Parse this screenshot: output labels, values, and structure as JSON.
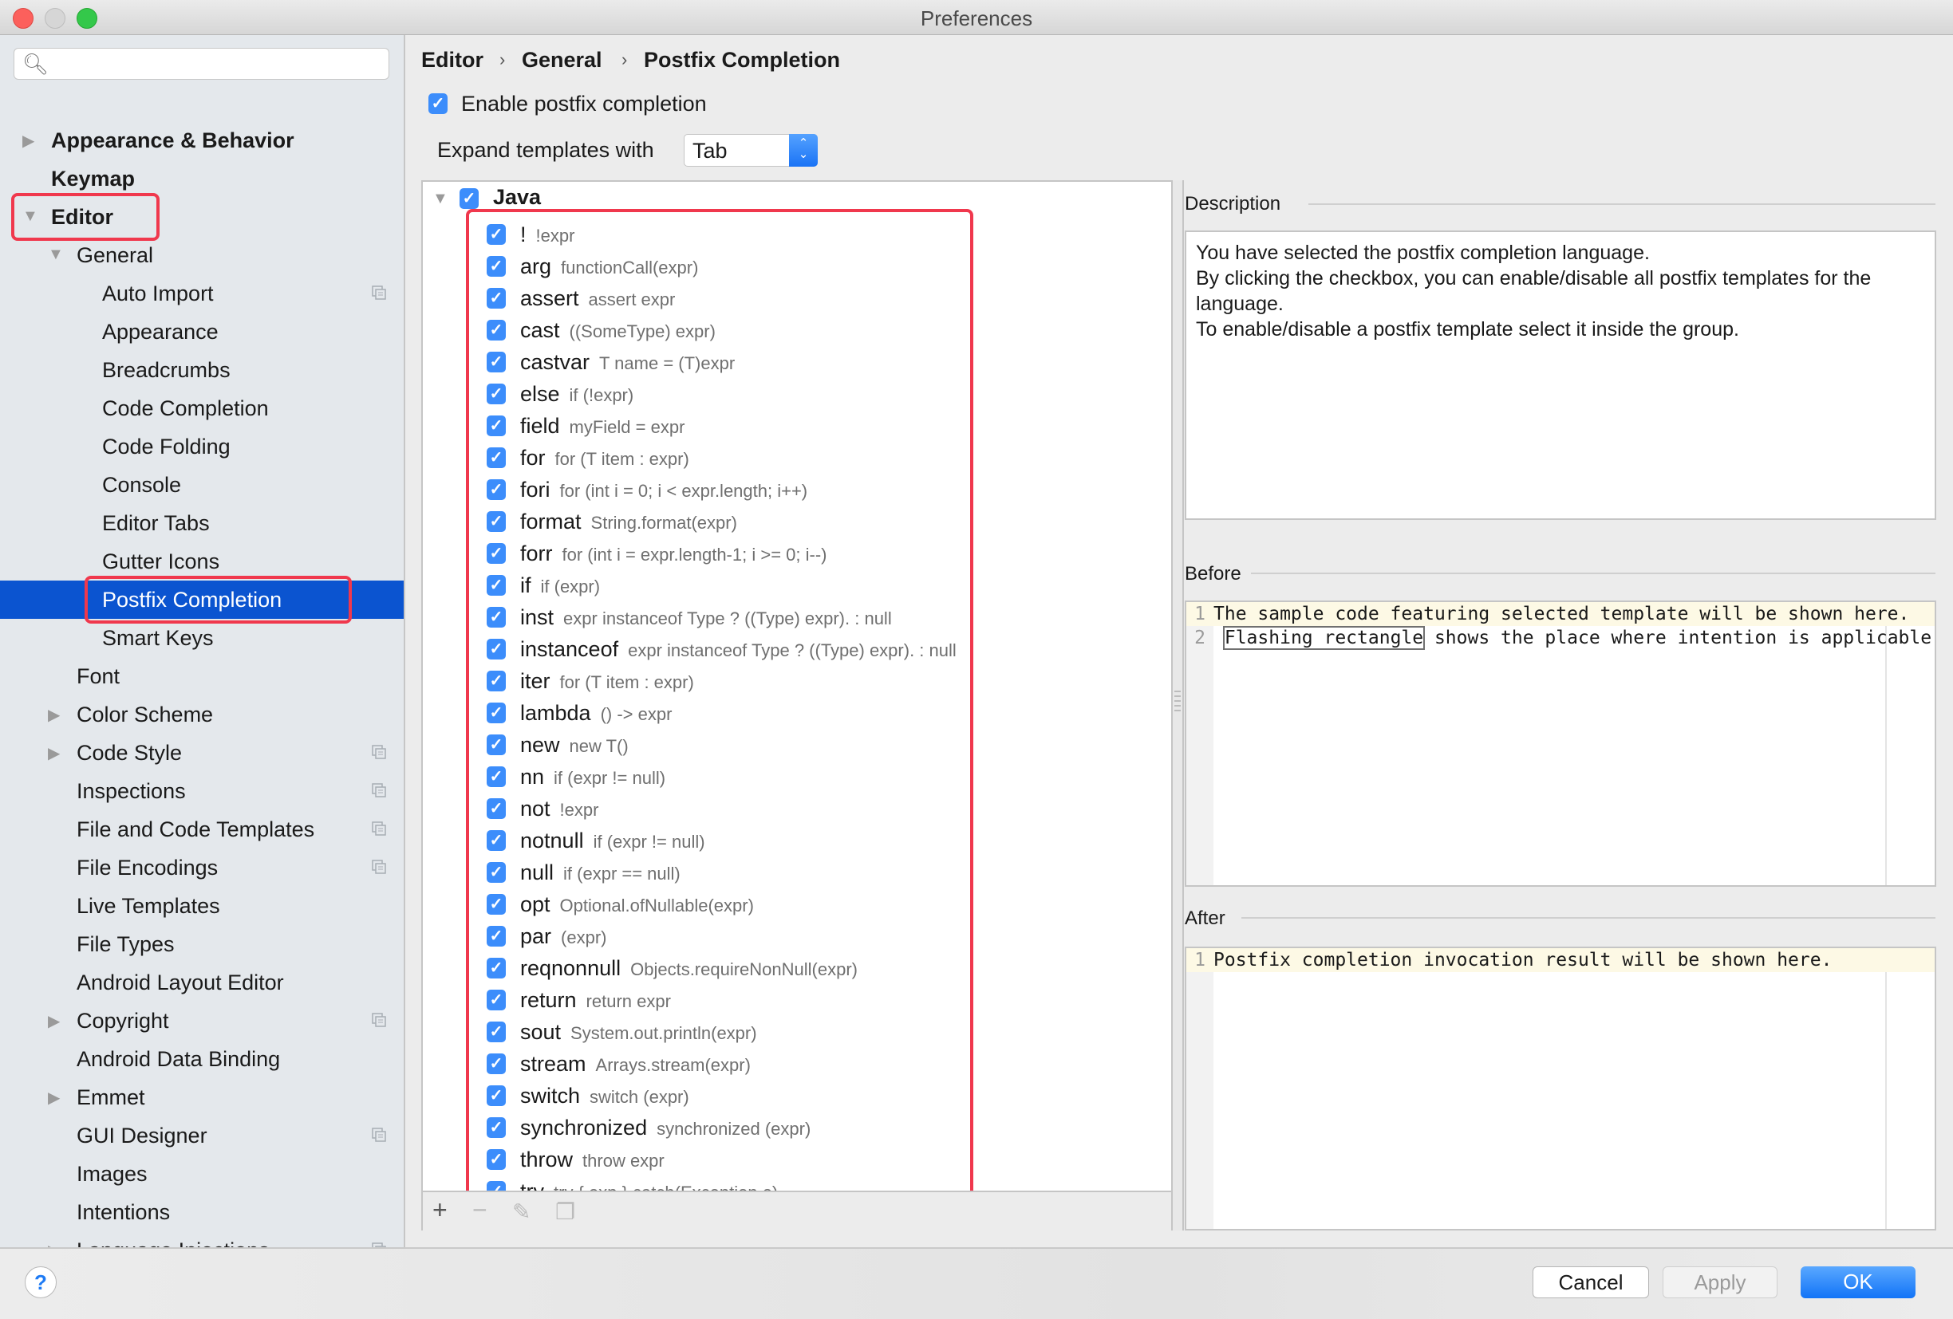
{
  "window": {
    "title": "Preferences"
  },
  "sidebar": {
    "search_placeholder": "",
    "items": [
      {
        "label": "Appearance & Behavior",
        "level": 0,
        "bold": true,
        "arrow": "collapsed",
        "project_icon": false
      },
      {
        "label": "Keymap",
        "level": 0,
        "bold": true,
        "arrow": "none",
        "project_icon": false
      },
      {
        "label": "Editor",
        "level": 0,
        "bold": true,
        "arrow": "expanded",
        "project_icon": false,
        "highlighted": true
      },
      {
        "label": "General",
        "level": 1,
        "bold": false,
        "arrow": "expanded",
        "project_icon": false
      },
      {
        "label": "Auto Import",
        "level": 2,
        "bold": false,
        "arrow": "none",
        "project_icon": true
      },
      {
        "label": "Appearance",
        "level": 2,
        "bold": false,
        "arrow": "none",
        "project_icon": false
      },
      {
        "label": "Breadcrumbs",
        "level": 2,
        "bold": false,
        "arrow": "none",
        "project_icon": false
      },
      {
        "label": "Code Completion",
        "level": 2,
        "bold": false,
        "arrow": "none",
        "project_icon": false
      },
      {
        "label": "Code Folding",
        "level": 2,
        "bold": false,
        "arrow": "none",
        "project_icon": false
      },
      {
        "label": "Console",
        "level": 2,
        "bold": false,
        "arrow": "none",
        "project_icon": false
      },
      {
        "label": "Editor Tabs",
        "level": 2,
        "bold": false,
        "arrow": "none",
        "project_icon": false
      },
      {
        "label": "Gutter Icons",
        "level": 2,
        "bold": false,
        "arrow": "none",
        "project_icon": false
      },
      {
        "label": "Postfix Completion",
        "level": 2,
        "bold": false,
        "arrow": "none",
        "project_icon": false,
        "selected": true,
        "highlighted": true
      },
      {
        "label": "Smart Keys",
        "level": 2,
        "bold": false,
        "arrow": "none",
        "project_icon": false
      },
      {
        "label": "Font",
        "level": 1,
        "bold": false,
        "arrow": "none",
        "project_icon": false
      },
      {
        "label": "Color Scheme",
        "level": 1,
        "bold": false,
        "arrow": "collapsed",
        "project_icon": false
      },
      {
        "label": "Code Style",
        "level": 1,
        "bold": false,
        "arrow": "collapsed",
        "project_icon": true
      },
      {
        "label": "Inspections",
        "level": 1,
        "bold": false,
        "arrow": "none",
        "project_icon": true
      },
      {
        "label": "File and Code Templates",
        "level": 1,
        "bold": false,
        "arrow": "none",
        "project_icon": true
      },
      {
        "label": "File Encodings",
        "level": 1,
        "bold": false,
        "arrow": "none",
        "project_icon": true
      },
      {
        "label": "Live Templates",
        "level": 1,
        "bold": false,
        "arrow": "none",
        "project_icon": false
      },
      {
        "label": "File Types",
        "level": 1,
        "bold": false,
        "arrow": "none",
        "project_icon": false
      },
      {
        "label": "Android Layout Editor",
        "level": 1,
        "bold": false,
        "arrow": "none",
        "project_icon": false
      },
      {
        "label": "Copyright",
        "level": 1,
        "bold": false,
        "arrow": "collapsed",
        "project_icon": true
      },
      {
        "label": "Android Data Binding",
        "level": 1,
        "bold": false,
        "arrow": "none",
        "project_icon": false
      },
      {
        "label": "Emmet",
        "level": 1,
        "bold": false,
        "arrow": "collapsed",
        "project_icon": false
      },
      {
        "label": "GUI Designer",
        "level": 1,
        "bold": false,
        "arrow": "none",
        "project_icon": true
      },
      {
        "label": "Images",
        "level": 1,
        "bold": false,
        "arrow": "none",
        "project_icon": false
      },
      {
        "label": "Intentions",
        "level": 1,
        "bold": false,
        "arrow": "none",
        "project_icon": false
      },
      {
        "label": "Language Injections",
        "level": 1,
        "bold": false,
        "arrow": "collapsed",
        "project_icon": true
      }
    ]
  },
  "breadcrumb": [
    "Editor",
    "General",
    "Postfix Completion"
  ],
  "breadcrumb_separator": "›",
  "enable_postfix": {
    "label": "Enable postfix completion",
    "checked": true
  },
  "expand_with": {
    "label": "Expand templates with",
    "value": "Tab"
  },
  "tree": {
    "group": {
      "label": "Java",
      "checked": true,
      "expanded": true
    },
    "templates": [
      {
        "key": "!",
        "desc": "!expr",
        "checked": true
      },
      {
        "key": "arg",
        "desc": "functionCall(expr)",
        "checked": true
      },
      {
        "key": "assert",
        "desc": "assert expr",
        "checked": true
      },
      {
        "key": "cast",
        "desc": "((SomeType) expr)",
        "checked": true
      },
      {
        "key": "castvar",
        "desc": "T name = (T)expr",
        "checked": true
      },
      {
        "key": "else",
        "desc": "if (!expr)",
        "checked": true
      },
      {
        "key": "field",
        "desc": "myField = expr",
        "checked": true
      },
      {
        "key": "for",
        "desc": "for (T item : expr)",
        "checked": true
      },
      {
        "key": "fori",
        "desc": "for (int i = 0; i < expr.length; i++)",
        "checked": true
      },
      {
        "key": "format",
        "desc": "String.format(expr)",
        "checked": true
      },
      {
        "key": "forr",
        "desc": "for (int i = expr.length-1; i >= 0; i--)",
        "checked": true
      },
      {
        "key": "if",
        "desc": "if (expr)",
        "checked": true
      },
      {
        "key": "inst",
        "desc": "expr instanceof Type ? ((Type) expr). : null",
        "checked": true
      },
      {
        "key": "instanceof",
        "desc": "expr instanceof Type ? ((Type) expr). : null",
        "checked": true
      },
      {
        "key": "iter",
        "desc": "for (T item : expr)",
        "checked": true
      },
      {
        "key": "lambda",
        "desc": "() -> expr",
        "checked": true
      },
      {
        "key": "new",
        "desc": "new T()",
        "checked": true
      },
      {
        "key": "nn",
        "desc": "if (expr != null)",
        "checked": true
      },
      {
        "key": "not",
        "desc": "!expr",
        "checked": true
      },
      {
        "key": "notnull",
        "desc": "if (expr != null)",
        "checked": true
      },
      {
        "key": "null",
        "desc": "if (expr == null)",
        "checked": true
      },
      {
        "key": "opt",
        "desc": "Optional.ofNullable(expr)",
        "checked": true
      },
      {
        "key": "par",
        "desc": "(expr)",
        "checked": true
      },
      {
        "key": "reqnonnull",
        "desc": "Objects.requireNonNull(expr)",
        "checked": true
      },
      {
        "key": "return",
        "desc": "return expr",
        "checked": true
      },
      {
        "key": "sout",
        "desc": "System.out.println(expr)",
        "checked": true
      },
      {
        "key": "stream",
        "desc": "Arrays.stream(expr)",
        "checked": true
      },
      {
        "key": "switch",
        "desc": "switch (expr)",
        "checked": true
      },
      {
        "key": "synchronized",
        "desc": "synchronized (expr)",
        "checked": true
      },
      {
        "key": "throw",
        "desc": "throw expr",
        "checked": true
      },
      {
        "key": "try",
        "desc": "try { exp } catch(Exception e)",
        "checked": true
      }
    ],
    "toolbar": {
      "add": "+",
      "remove": "−",
      "edit": "edit-icon",
      "copy": "copy-icon"
    }
  },
  "description": {
    "title": "Description",
    "lines": [
      "You have selected the postfix completion language.",
      "By clicking the checkbox, you can enable/disable all postfix templates for the language.",
      "To enable/disable a postfix template select it inside the group."
    ]
  },
  "before": {
    "title": "Before",
    "lines": [
      {
        "n": "1",
        "text": "The sample code featuring selected template will be shown here."
      },
      {
        "n": "2",
        "flash": "Flashing rectangle",
        "text": " shows the place where intention is applicable"
      }
    ]
  },
  "after": {
    "title": "After",
    "lines": [
      {
        "n": "1",
        "text": "Postfix completion invocation result will be shown here."
      }
    ]
  },
  "footer": {
    "help": "?",
    "cancel": "Cancel",
    "apply": "Apply",
    "ok": "OK",
    "apply_enabled": false
  },
  "colors": {
    "accent": "#0b54d0",
    "checkbox": "#3c8dfb",
    "highlight_box": "#f0384d",
    "ok_button": "#1274f7"
  }
}
